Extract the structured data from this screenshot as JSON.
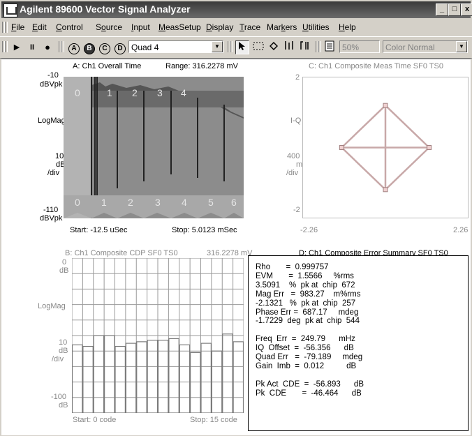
{
  "window": {
    "title": "Agilent 89600 Vector Signal Analyzer",
    "min_glyph": "_",
    "max_glyph": "□",
    "close_glyph": "x"
  },
  "menu": [
    {
      "accel": "F",
      "rest": "ile"
    },
    {
      "accel": "E",
      "rest": "dit"
    },
    {
      "accel": "C",
      "rest": "ontrol"
    },
    {
      "pre": "S",
      "accel": "o",
      "rest": "urce"
    },
    {
      "accel": "I",
      "rest": "nput"
    },
    {
      "accel": "M",
      "rest": "easSetup"
    },
    {
      "accel": "D",
      "rest": "isplay"
    },
    {
      "accel": "T",
      "rest": "race"
    },
    {
      "pre": "Mar",
      "accel": "k",
      "rest": "ers"
    },
    {
      "accel": "U",
      "rest": "tilities"
    },
    {
      "accel": "H",
      "rest": "elp"
    }
  ],
  "toolbar": {
    "play": "▶",
    "pause": "II",
    "record": "●",
    "trace_a": "A",
    "trace_b": "B",
    "trace_c": "C",
    "trace_d": "D",
    "layout": "Quad 4",
    "zoom": "50%",
    "color": "Color Normal"
  },
  "trace_a": {
    "title": "A: Ch1 Overall Time",
    "range": "Range: 316.2278 mV",
    "top_value": "-10",
    "top_unit": "dBVpk",
    "yformat": "LogMag",
    "scale_value": "10",
    "scale_unit": "dB",
    "scale_div": "/div",
    "bottom_value": "-110",
    "bottom_unit": "dBVpk",
    "start": "Start: -12.5 uSec",
    "stop": "Stop: 5.0123 mSec",
    "top_slots": [
      "0",
      "1",
      "2",
      "3",
      "4"
    ],
    "bottom_slots": [
      "0",
      "1",
      "2",
      "3",
      "4",
      "5",
      "6"
    ]
  },
  "trace_b": {
    "title": "B: Ch1 Composite CDP SF0 TS0",
    "range": "316.2278 mV",
    "top_value": "0",
    "top_unit": "dB",
    "yformat": "LogMag",
    "scale_value": "10",
    "scale_unit": "dB",
    "scale_div": "/div",
    "bottom_value": "-100",
    "bottom_unit": "dB",
    "start": "Start: 0  code",
    "stop": "Stop: 15  code"
  },
  "trace_c": {
    "title": "C: Ch1 Composite Meas Time SF0 TS0",
    "top_value": "2",
    "yformat": "I-Q",
    "scale_value": "400",
    "scale_unit": "m",
    "scale_div": "/div",
    "bottom_value": "-2",
    "xmin": "-2.26",
    "xmax": "2.26"
  },
  "trace_d": {
    "title": "D: Ch1 Composite Error Summary SF0 TS0",
    "rows": [
      "Rho       =  0.999757",
      "EVM       =  1.5566     %rms",
      "3.5091    %  pk at  chip  672",
      "Mag Err   =  983.27    m%rms",
      "-2.1321   %  pk at  chip  257",
      "Phase Err =  687.17     mdeg",
      "-1.7229  deg  pk at  chip  544",
      "",
      "Freq  Err  =  249.79      mHz",
      "IQ  Offset  =  -56.356      dB",
      "Quad Err   =  -79.189     mdeg",
      "Gain  Imb  =  0.012          dB",
      "",
      "Pk Act  CDE  =  -56.893      dB",
      "Pk  CDE       =  -46.464      dB"
    ]
  },
  "chart_data": [
    {
      "type": "line",
      "title": "A: Ch1 Overall Time",
      "xlabel": "",
      "ylabel": "LogMag",
      "xlim": [
        -0.0125,
        5.0123
      ],
      "ylim": [
        -110,
        -10
      ],
      "x_unit": "mSec",
      "y_unit": "dBVpk",
      "note": "",
      "slots": [
        0,
        1,
        2,
        3,
        4,
        5,
        6
      ]
    },
    {
      "type": "bar",
      "title": "B: Ch1 Composite CDP SF0 TS0",
      "categories": [
        "0",
        "1",
        "2",
        "3",
        "4",
        "5",
        "6",
        "7",
        "8",
        "9",
        "10",
        "11",
        "12",
        "13",
        "14",
        "15"
      ],
      "values": [
        -56,
        -57,
        -50,
        -50,
        -57,
        -55,
        -54,
        -53,
        -53,
        -52,
        -56,
        -61,
        -55,
        -60,
        -49,
        -54
      ],
      "ylim": [
        -100,
        0
      ],
      "ylabel": "LogMag",
      "y_unit": "dB"
    },
    {
      "type": "scatter",
      "title": "C: Ch1 Composite Meas Time SF0 TS0",
      "ylabel": "I-Q",
      "xlim": [
        -2.26,
        2.26
      ],
      "ylim": [
        -2,
        2
      ],
      "points": [
        [
          0,
          1.2
        ],
        [
          1.2,
          0
        ],
        [
          0,
          -1.2
        ],
        [
          -1.2,
          0
        ]
      ]
    }
  ]
}
